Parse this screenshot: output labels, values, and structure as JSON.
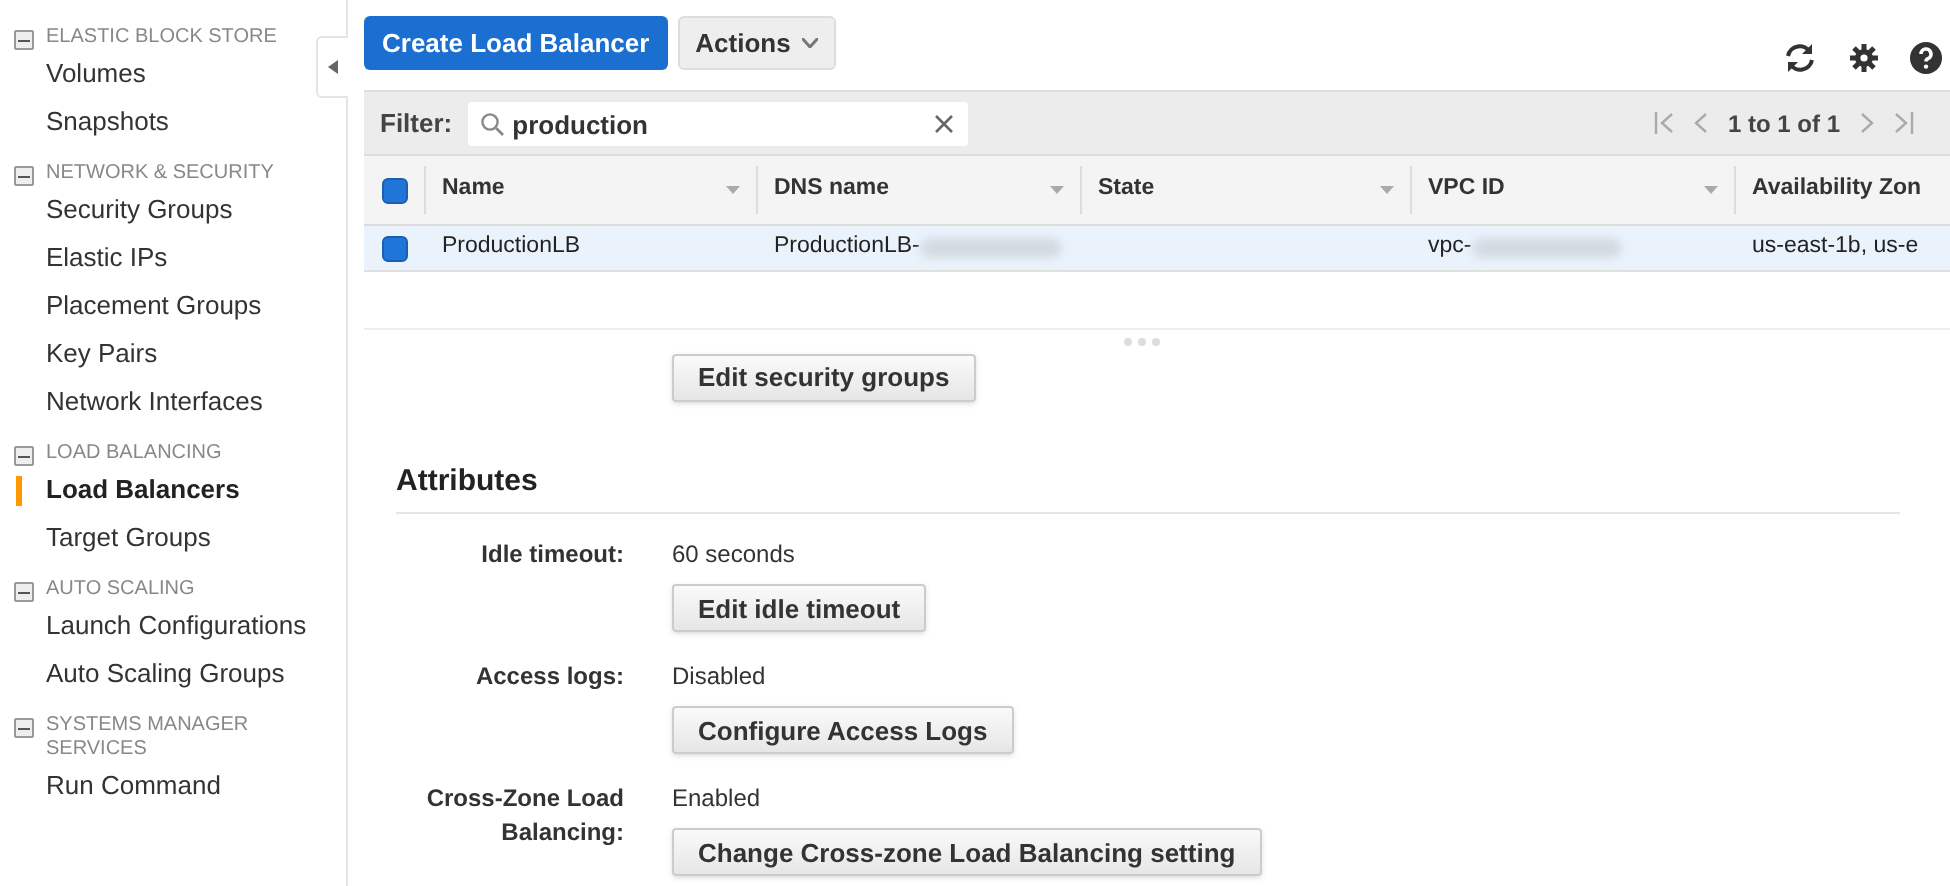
{
  "sidebar": {
    "sections": [
      {
        "title": "ELASTIC BLOCK STORE",
        "expanded": true,
        "items": [
          {
            "label": "Volumes",
            "selected": false
          },
          {
            "label": "Snapshots",
            "selected": false
          }
        ]
      },
      {
        "title": "NETWORK & SECURITY",
        "expanded": true,
        "items": [
          {
            "label": "Security Groups",
            "selected": false
          },
          {
            "label": "Elastic IPs",
            "selected": false
          },
          {
            "label": "Placement Groups",
            "selected": false
          },
          {
            "label": "Key Pairs",
            "selected": false
          },
          {
            "label": "Network Interfaces",
            "selected": false
          }
        ]
      },
      {
        "title": "LOAD BALANCING",
        "expanded": true,
        "items": [
          {
            "label": "Load Balancers",
            "selected": true
          },
          {
            "label": "Target Groups",
            "selected": false
          }
        ]
      },
      {
        "title": "AUTO SCALING",
        "expanded": true,
        "items": [
          {
            "label": "Launch Configurations",
            "selected": false
          },
          {
            "label": "Auto Scaling Groups",
            "selected": false
          }
        ]
      },
      {
        "title": "SYSTEMS MANAGER SERVICES",
        "expanded": true,
        "items": [
          {
            "label": "Run Command",
            "selected": false
          }
        ]
      }
    ]
  },
  "toolbar": {
    "primary_button": "Create Load Balancer",
    "actions_button": "Actions"
  },
  "filter": {
    "label": "Filter:",
    "value": "production"
  },
  "pagination": "1 to 1 of 1",
  "table": {
    "all_checked": true,
    "columns": [
      "Name",
      "DNS name",
      "State",
      "VPC ID",
      "Availability Zon"
    ],
    "rows": [
      {
        "selected": true,
        "cells": [
          "ProductionLB",
          "ProductionLB-",
          "",
          "vpc-",
          "us-east-1b, us-e"
        ],
        "redacted": [
          false,
          true,
          false,
          true,
          false
        ]
      }
    ]
  },
  "details": {
    "security_button": "Edit security groups",
    "heading": "Attributes",
    "attributes": [
      {
        "label": "Idle timeout:",
        "value": "60 seconds",
        "button": "Edit idle timeout"
      },
      {
        "label": "Access logs:",
        "value": "Disabled",
        "button": "Configure Access Logs"
      },
      {
        "label": "Cross-Zone Load Balancing:",
        "value": "Enabled",
        "button": "Change Cross-zone Load Balancing setting"
      }
    ]
  }
}
